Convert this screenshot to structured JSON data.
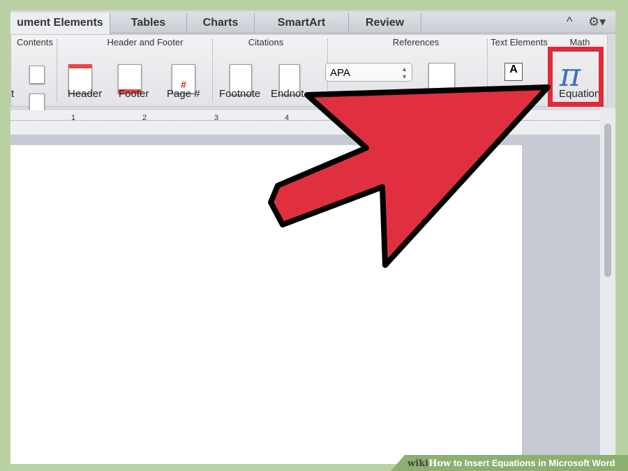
{
  "tabs": [
    {
      "label": "ument Elements",
      "active": true
    },
    {
      "label": "Tables"
    },
    {
      "label": "Charts"
    },
    {
      "label": "SmartArt"
    },
    {
      "label": "Review"
    }
  ],
  "controls": {
    "collapse": "^",
    "settings": "⚙▾"
  },
  "groups": {
    "contents": "Contents",
    "header_footer": "Header and Footer",
    "citations": "Citations",
    "references": "References",
    "text_elements": "Text Elements",
    "math": "Math"
  },
  "buttons": {
    "partial": "t",
    "header": "Header",
    "footer": "Footer",
    "page_number": "Page #",
    "page_number_glyph": "#",
    "footnote": "Footnote",
    "endnote": "Endnot",
    "equation": "Equation",
    "equation_glyph": "π",
    "textbox_glyph": "A"
  },
  "references": {
    "style_select": "APA"
  },
  "ruler": {
    "marks": [
      "1",
      "2",
      "3",
      "4"
    ]
  },
  "colors": {
    "accent_red": "#e02a3a",
    "background_green": "#b9d1a3"
  },
  "watermark": {
    "brand": "wiki",
    "how": "How",
    "title": "to Insert Equations in Microsoft Word"
  }
}
